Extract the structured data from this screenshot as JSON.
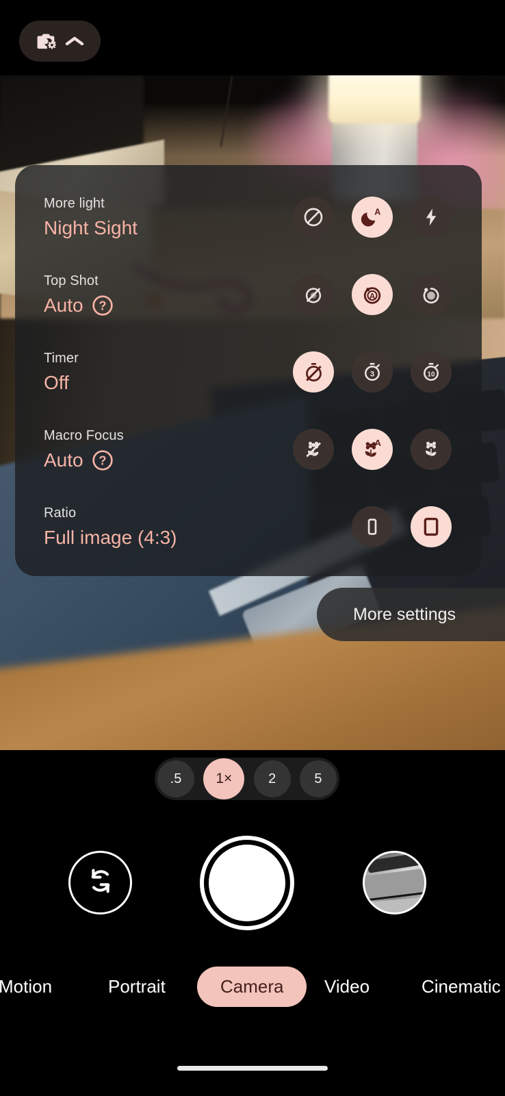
{
  "topbar": {
    "settings_pill": {
      "camera_settings_icon": "camera-settings-icon",
      "chevron_icon": "chevron-up-icon"
    }
  },
  "panel": {
    "options": [
      {
        "title": "More light",
        "value": "Night Sight",
        "has_help": false,
        "choices": [
          {
            "icon": "night-sight-off-icon",
            "selected": false
          },
          {
            "icon": "night-sight-auto-icon",
            "selected": true
          },
          {
            "icon": "flash-on-icon",
            "selected": false
          }
        ]
      },
      {
        "title": "Top Shot",
        "value": "Auto",
        "has_help": true,
        "choices": [
          {
            "icon": "top-shot-off-icon",
            "selected": false
          },
          {
            "icon": "top-shot-auto-icon",
            "selected": true
          },
          {
            "icon": "top-shot-on-icon",
            "selected": false
          }
        ]
      },
      {
        "title": "Timer",
        "value": "Off",
        "has_help": false,
        "choices": [
          {
            "icon": "timer-off-icon",
            "selected": true
          },
          {
            "icon": "timer-3s-icon",
            "selected": false
          },
          {
            "icon": "timer-10s-icon",
            "selected": false
          }
        ]
      },
      {
        "title": "Macro Focus",
        "value": "Auto",
        "has_help": true,
        "choices": [
          {
            "icon": "macro-off-icon",
            "selected": false
          },
          {
            "icon": "macro-auto-icon",
            "selected": true
          },
          {
            "icon": "macro-on-icon",
            "selected": false
          }
        ]
      },
      {
        "title": "Ratio",
        "value": "Full image (4:3)",
        "has_help": false,
        "choices": [
          {
            "icon": "ratio-9-16-icon",
            "selected": false
          },
          {
            "icon": "ratio-4-3-icon",
            "selected": true
          }
        ]
      }
    ]
  },
  "more_settings": {
    "label": "More settings"
  },
  "zoom": {
    "levels": [
      {
        "label": ".5",
        "selected": false
      },
      {
        "label": "1×",
        "selected": true
      },
      {
        "label": "2",
        "selected": false
      },
      {
        "label": "5",
        "selected": false
      }
    ]
  },
  "controls": {
    "flip_icon": "flip-camera-icon",
    "shutter": "shutter-button",
    "thumbnail": "last-photo-thumbnail"
  },
  "modes": [
    {
      "label": "Motion",
      "selected": false
    },
    {
      "label": "Portrait",
      "selected": false
    },
    {
      "label": "Camera",
      "selected": true
    },
    {
      "label": "Video",
      "selected": false
    },
    {
      "label": "Cinematic",
      "selected": false
    }
  ],
  "colors": {
    "accent_pink": "#f3c4bc",
    "value_text": "#f7b3a6",
    "panel_bg": "#1c1e21",
    "icon_dark": "#3a1d18"
  }
}
